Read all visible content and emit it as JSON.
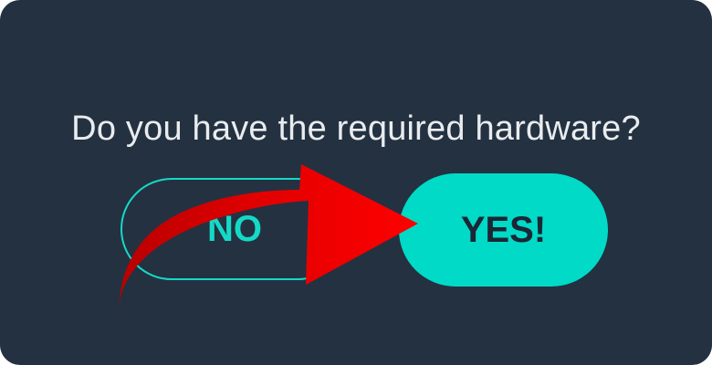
{
  "dialog": {
    "question": "Do you have the required hardware?",
    "no_label": "NO",
    "yes_label": "YES!"
  },
  "colors": {
    "background": "#243141",
    "accent": "#00dac7",
    "annotation_arrow": "#e30000"
  },
  "annotation": {
    "icon": "curved-arrow-icon"
  }
}
